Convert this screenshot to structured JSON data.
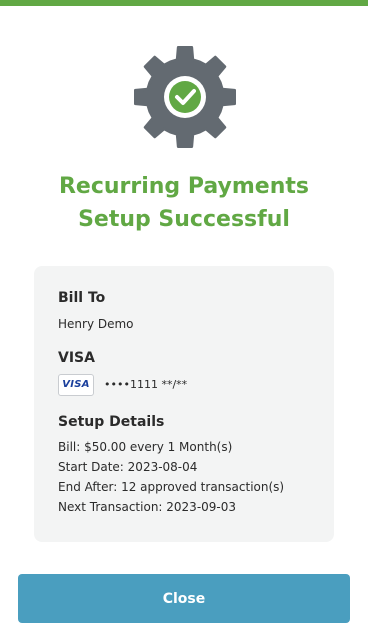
{
  "colors": {
    "accent_green": "#61a844",
    "gear_gray": "#636a71",
    "visa_blue": "#1a3f9c",
    "button_blue": "#4a9ebf"
  },
  "header": {
    "title_line1": "Recurring Payments",
    "title_line2": "Setup Successful",
    "icon": "gear-check-icon"
  },
  "bill_to": {
    "heading": "Bill To",
    "name": "Henry Demo"
  },
  "payment": {
    "heading": "VISA",
    "brand_badge": "VISA",
    "card_mask": "••••1111 **/**"
  },
  "setup_details": {
    "heading": "Setup Details",
    "bill": "Bill: $50.00 every 1 Month(s)",
    "start_date": "Start Date: 2023-08-04",
    "end_after": "End After: 12 approved transaction(s)",
    "next_transaction": "Next Transaction: 2023-09-03"
  },
  "actions": {
    "close_label": "Close"
  }
}
